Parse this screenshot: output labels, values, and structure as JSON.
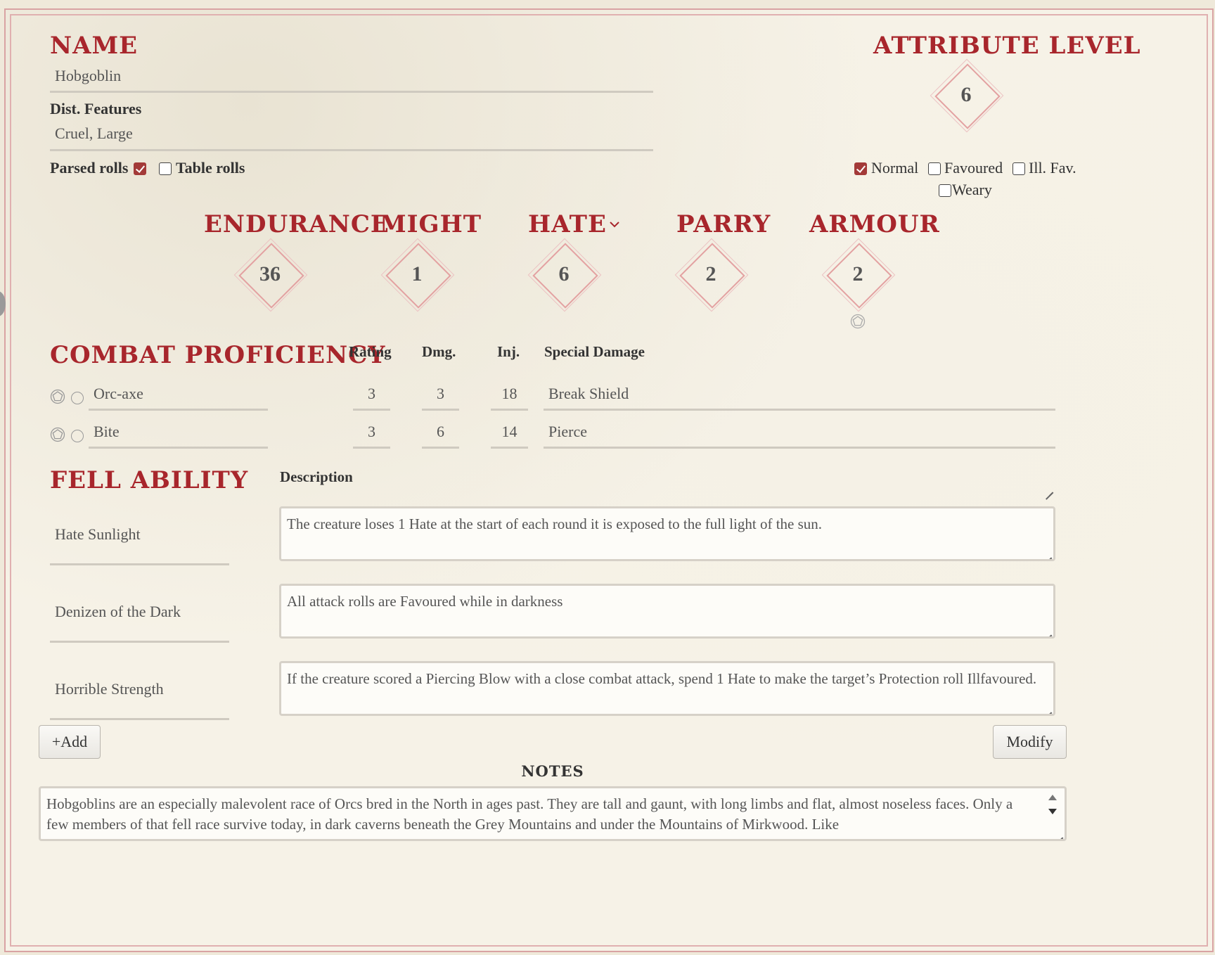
{
  "header": {
    "name_title": "NAME",
    "name_value": "Hobgoblin",
    "features_label": "Dist. Features",
    "features_value": "Cruel, Large",
    "attribute_title": "ATTRIBUTE LEVEL",
    "attribute_value": "6"
  },
  "rolls": {
    "parsed_label": "Parsed rolls",
    "parsed_checked": true,
    "table_label": "Table rolls",
    "table_checked": false
  },
  "state": {
    "normal_label": "Normal",
    "normal_checked": true,
    "favoured_label": "Favoured",
    "ill_fav_label": "Ill. Fav.",
    "weary_label": "Weary"
  },
  "stats": [
    {
      "title": "ENDURANCE",
      "value": "36"
    },
    {
      "title": "MIGHT",
      "value": "1"
    },
    {
      "title": "HATE",
      "value": "6"
    },
    {
      "title": "PARRY",
      "value": "2"
    },
    {
      "title": "ARMOUR",
      "value": "2"
    }
  ],
  "combat": {
    "title": "COMBAT PROFICIENCY",
    "headers": {
      "rating": "Rating",
      "dmg": "Dmg.",
      "inj": "Inj.",
      "special": "Special Damage"
    },
    "rows": [
      {
        "name": "Orc-axe",
        "rating": "3",
        "dmg": "3",
        "inj": "18",
        "special": "Break Shield"
      },
      {
        "name": "Bite",
        "rating": "3",
        "dmg": "6",
        "inj": "14",
        "special": "Pierce"
      }
    ]
  },
  "fell": {
    "title": "FELL ABILITY",
    "desc_header": "Description",
    "abilities": [
      {
        "name": "Hate Sunlight",
        "desc": "The creature loses 1 Hate at the start of each round it is exposed to the full light of the sun."
      },
      {
        "name": "Denizen of the Dark",
        "desc": "All attack rolls are Favoured while in darkness"
      },
      {
        "name": "Horrible Strength",
        "desc": "If the creature scored a Piercing Blow with a close combat attack, spend 1 Hate to make the target’s Protection roll Illfavoured."
      }
    ],
    "add_label": "+Add",
    "modify_label": "Modify"
  },
  "notes": {
    "title": "NOTES",
    "text": "Hobgoblins are an especially malevolent race of Orcs bred in the North in ages past. They are tall and gaunt, with long limbs and flat, almost noseless faces. Only a few members of that fell race survive today, in dark caverns beneath the Grey Mountains and under the Mountains of Mirkwood. Like"
  },
  "colors": {
    "accent": "#a8262c",
    "diamond": "#e3a1a1",
    "checkbox": "#a33a38"
  }
}
